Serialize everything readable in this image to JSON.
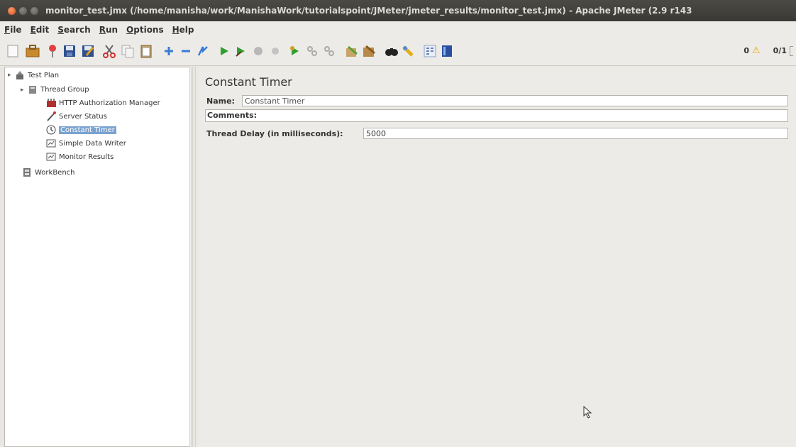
{
  "window": {
    "title": "monitor_test.jmx (/home/manisha/work/ManishaWork/tutorialspoint/JMeter/jmeter_results/monitor_test.jmx) - Apache JMeter (2.9 r143"
  },
  "menu": [
    {
      "mnemonic": "F",
      "rest": "ile"
    },
    {
      "mnemonic": "E",
      "rest": "dit"
    },
    {
      "mnemonic": "S",
      "rest": "earch"
    },
    {
      "mnemonic": "R",
      "rest": "un"
    },
    {
      "mnemonic": "O",
      "rest": "ptions"
    },
    {
      "mnemonic": "H",
      "rest": "elp"
    }
  ],
  "toolbar": {
    "icons": [
      "new-icon",
      "templates-icon",
      "open-icon",
      "save-icon",
      "save-as-icon",
      "cut-icon",
      "copy-icon",
      "paste-icon",
      "expand-icon",
      "collapse-icon",
      "toggle-icon",
      "start-icon",
      "start-no-pause-icon",
      "stop-icon",
      "shutdown-icon",
      "remote-start-icon",
      "remote-stop-icon",
      "remote-shutdown-icon",
      "clear-icon",
      "clear-all-icon",
      "search-icon",
      "reset-search-icon",
      "function-helper-icon",
      "help-icon"
    ],
    "warnings": "0",
    "threads": "0/1"
  },
  "tree": {
    "nodes": [
      {
        "label": "Test Plan",
        "icon": "test-plan-icon"
      },
      {
        "label": "Thread Group",
        "icon": "thread-group-icon"
      },
      {
        "label": "HTTP Authorization Manager",
        "icon": "auth-manager-icon"
      },
      {
        "label": "Server Status",
        "icon": "sampler-icon"
      },
      {
        "label": "Constant Timer",
        "icon": "timer-icon",
        "selected": true
      },
      {
        "label": "Simple Data Writer",
        "icon": "listener-icon"
      },
      {
        "label": "Monitor Results",
        "icon": "listener-icon"
      },
      {
        "label": "WorkBench",
        "icon": "workbench-icon"
      }
    ]
  },
  "panel": {
    "title": "Constant Timer",
    "name_label": "Name:",
    "name_value": "Constant Timer",
    "comments_label": "Comments:",
    "comments_value": "",
    "delay_label": "Thread Delay (in milliseconds):",
    "delay_value": "5000"
  },
  "colors": {
    "title_bar": "#3f3e3a",
    "selection": "#7aa3cf",
    "panel_bg": "#edebe7"
  }
}
